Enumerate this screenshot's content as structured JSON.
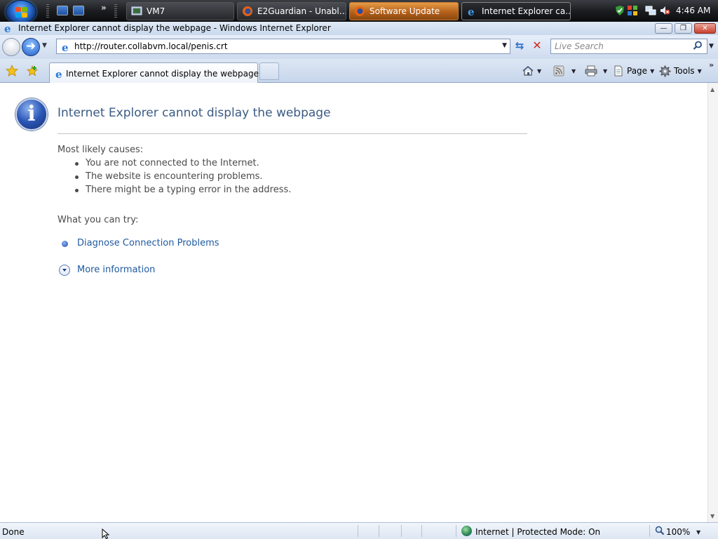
{
  "taskbar": {
    "buttons": [
      {
        "label": "VM7"
      },
      {
        "label": "E2Guardian - Unabl..."
      },
      {
        "label": "Software Update"
      },
      {
        "label": "Internet Explorer ca..."
      }
    ],
    "clock": "4:46 AM",
    "quick_launch_more": "»"
  },
  "window": {
    "title": "Internet Explorer cannot display the webpage - Windows Internet Explorer",
    "minimize_label": "—",
    "maximize_label": "❐",
    "close_label": "✕"
  },
  "navigation": {
    "address": "http://router.collabvm.local/penis.crt",
    "search_placeholder": "Live Search",
    "forward_glyph": "➜",
    "refresh_glyph": "⇆",
    "stop_glyph": "✕"
  },
  "tabs": {
    "active_label": "Internet Explorer cannot display the webpage"
  },
  "command_bar": {
    "page_label": "Page",
    "tools_label": "Tools"
  },
  "error_page": {
    "title": "Internet Explorer cannot display the webpage",
    "causes_heading": "Most likely causes:",
    "causes": [
      "You are not connected to the Internet.",
      "The website is encountering problems.",
      "There might be a typing error in the address."
    ],
    "try_heading": "What you can try:",
    "diagnose_link": "Diagnose Connection Problems",
    "more_info_link": "More information",
    "info_glyph": "i"
  },
  "statusbar": {
    "status": "Done",
    "zone": "Internet | Protected Mode: On",
    "zoom": "100%"
  },
  "colors": {
    "title_blue": "#3b5b84",
    "link_blue": "#1f5aa0",
    "flash_orange": "#e69b46",
    "close_red": "#c8402e"
  },
  "icons": [
    "windows-logo-icon",
    "show-desktop-icon",
    "switch-windows-icon",
    "vm-icon",
    "firefox-icon",
    "ie-icon",
    "home-icon",
    "feeds-icon",
    "print-icon",
    "page-icon",
    "gear-icon",
    "star-icon",
    "add-favorites-icon",
    "search-icon",
    "info-icon",
    "globe-icon",
    "magnifier-icon",
    "mouse-cursor-icon"
  ]
}
